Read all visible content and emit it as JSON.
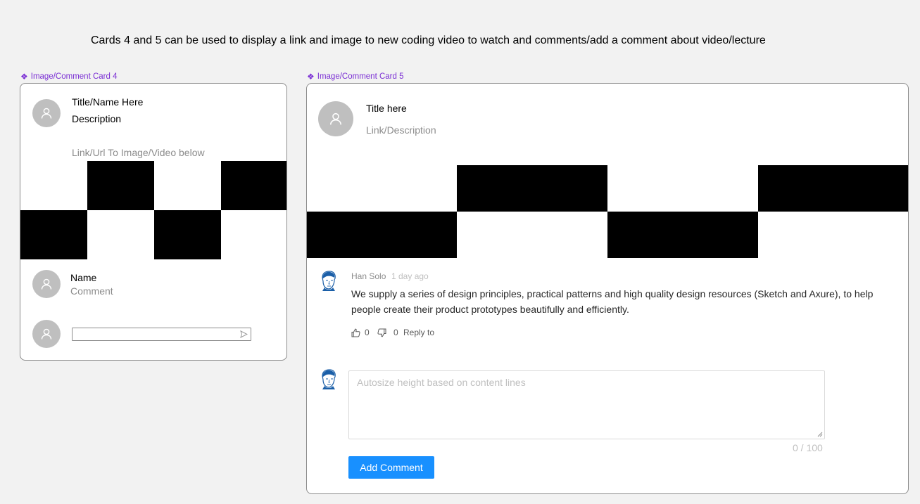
{
  "heading": "Cards 4 and 5 can be used to display a link and image to new coding video to watch and comments/add a comment about video/lecture",
  "card4": {
    "frame_label": "Image/Comment Card 4",
    "title": "Title/Name Here",
    "description": "Description",
    "link_text": "Link/Url To Image/Video below",
    "comment_name": "Name",
    "comment_text": "Comment",
    "input_value": ""
  },
  "card5": {
    "frame_label": "Image/Comment Card 5",
    "title": "Title here",
    "subtitle": "Link/Description",
    "comment": {
      "author": "Han Solo",
      "time": "1 day ago",
      "content_line1": "We supply a series of design principles, practical patterns and high quality design resources (Sketch and Axure), to help",
      "content_line2": "people create their product prototypes beautifully and efficiently.",
      "likes": "0",
      "dislikes": "0",
      "reply_label": "Reply to"
    },
    "editor": {
      "placeholder": "Autosize height based on content lines",
      "counter": "0 / 100",
      "submit_label": "Add Comment"
    }
  },
  "colors": {
    "background": "#f2f2f2",
    "frame_label": "#7b2fd4",
    "primary": "#1890ff",
    "avatar": "#bfbfbf",
    "secondary_text": "#8c8c8c"
  },
  "icons": [
    "component-icon",
    "user-icon",
    "send-icon",
    "like-icon",
    "dislike-icon",
    "user-avatar-face"
  ]
}
